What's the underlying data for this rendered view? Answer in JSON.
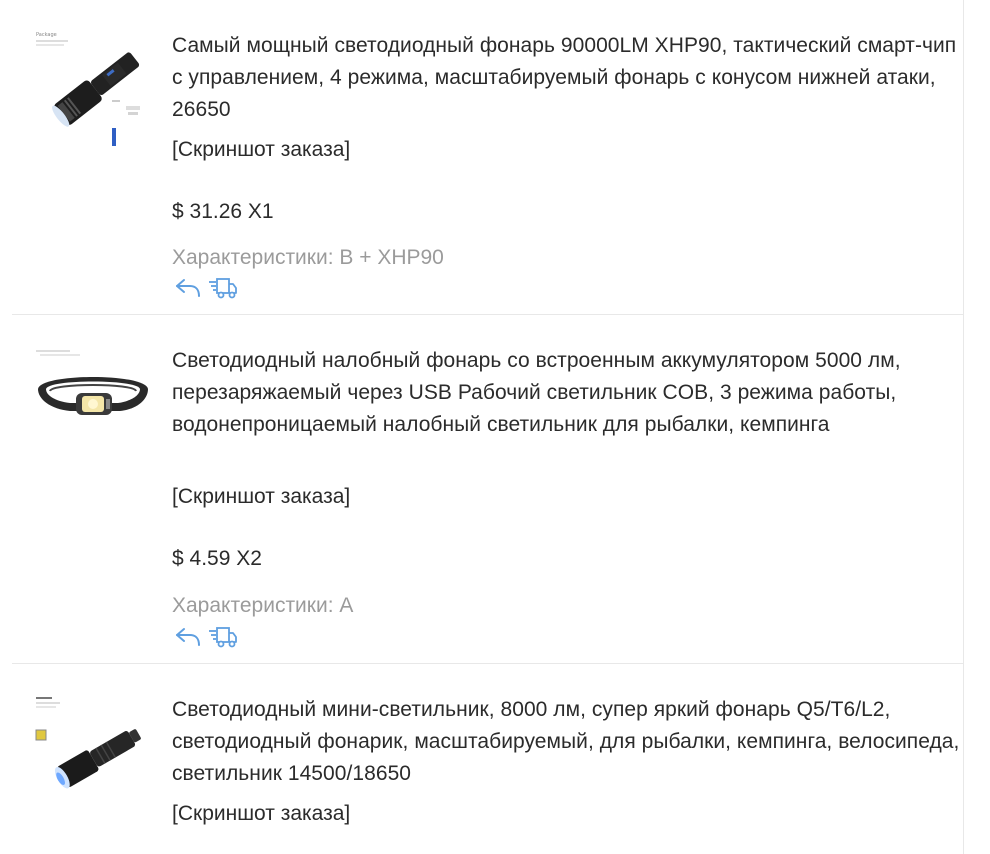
{
  "colors": {
    "text": "#2b2b2b",
    "muted": "#9b9b9b",
    "icon": "#5f9fe0",
    "divider": "#e8e8e8"
  },
  "orders": [
    {
      "title": "Самый мощный светодиодный фонарь 90000LM XHP90, тактический смарт-чип с управлением, 4 режима, масштабируемый фонарь с конусом нижней атаки, 26650",
      "snapshot_label": "[Скриншот заказа]",
      "price": "$ 31.26 X1",
      "specs": "Характеристики: B + XHP90",
      "thumbnail": "flashlight-zoom-icon",
      "actions": [
        "return-arrow-icon",
        "shipping-truck-icon"
      ]
    },
    {
      "title": "Светодиодный налобный фонарь со встроенным аккумулятором 5000 лм, перезаряжаемый через USB Рабочий светильник COB, 3 режима работы, водонепроницаемый налобный светильник для рыбалки, кемпинга",
      "snapshot_label": "[Скриншот заказа]",
      "price": "$ 4.59 X2",
      "specs": "Характеристики: A",
      "thumbnail": "headlamp-icon",
      "actions": [
        "return-arrow-icon",
        "shipping-truck-icon"
      ]
    },
    {
      "title": "Светодиодный мини-светильник, 8000 лм, супер яркий фонарь Q5/T6/L2, светодиодный фонарик, масштабируемый, для рыбалки, кемпинга, велосипеда, светильник 14500/18650",
      "snapshot_label": "[Скриншот заказа]",
      "thumbnail": "mini-flashlight-icon"
    }
  ]
}
